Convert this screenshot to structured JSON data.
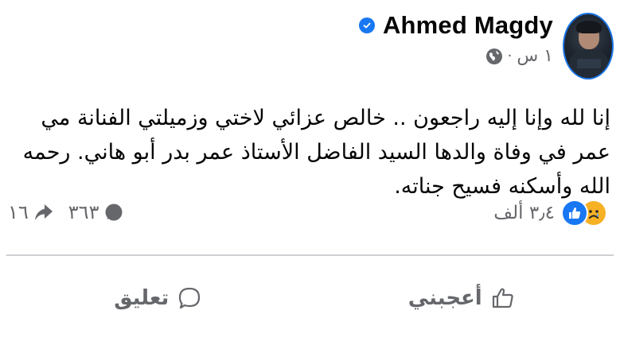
{
  "author": {
    "name": "Ahmed Magdy",
    "verified": true
  },
  "post": {
    "time": "١ س",
    "separator": "·",
    "text": "إنا لله وإنا إليه راجعون .. خالص عزائي لاختي وزميلتي الفنانة مي عمر في وفاة والدها السيد الفاضل الأستاذ عمر بدر أبو هاني. رحمه الله وأسكنه فسيح جناته."
  },
  "stats": {
    "reactions_count": "٣٫٤ ألف",
    "comments_count": "٣٦٣",
    "shares_count": "١٦"
  },
  "actions": {
    "like_label": "أعجبني",
    "comment_label": "تعليق"
  },
  "colors": {
    "brand": "#1877f2",
    "muted": "#65676b",
    "sad": "#f7b125"
  },
  "icons": [
    "verified-icon",
    "globe-icon",
    "like-reaction-icon",
    "sad-reaction-icon",
    "comment-icon",
    "share-icon",
    "thumbs-up-icon",
    "comment-bubble-icon"
  ]
}
